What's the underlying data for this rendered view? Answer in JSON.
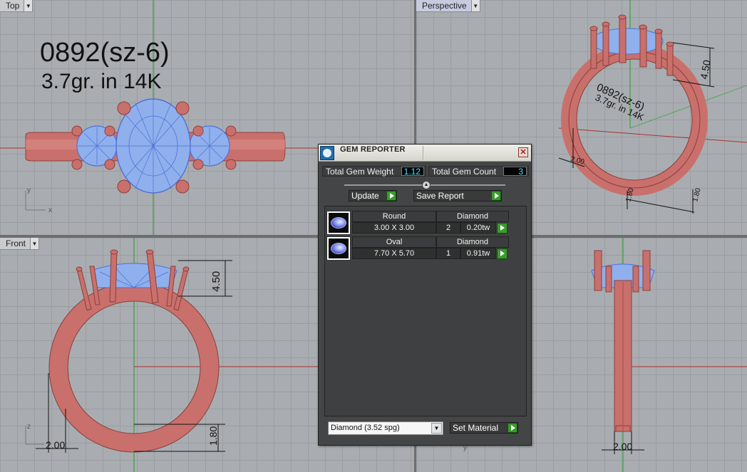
{
  "viewports": {
    "top": {
      "label": "Top",
      "annotation_line1": "0892(sz-6)",
      "annotation_line2": "3.7gr.  in 14K",
      "axis_y": "y",
      "axis_x": "x"
    },
    "perspective": {
      "label": "Perspective",
      "annotation_line1": "0892(sz-6)",
      "annotation_line2": "3.7gr.  in 14K",
      "dim_height": "4.50",
      "dim_left": "2.00",
      "dim_bottom_a": "1.80",
      "dim_bottom_b": "1.80"
    },
    "front": {
      "label": "Front",
      "dim_height": "4.50",
      "dim_width": "2.00",
      "dim_band": "1.80",
      "axis_z": "z"
    },
    "right": {
      "dim_width": "2.00",
      "axis_y": "y"
    }
  },
  "gem_reporter": {
    "title": "GEM REPORTER",
    "total_weight_label": "Total Gem Weight",
    "total_weight_value": "1.12",
    "total_count_label": "Total Gem Count",
    "total_count_value": "3",
    "update_label": "Update",
    "save_report_label": "Save Report",
    "gems": [
      {
        "shape": "Round",
        "material": "Diamond",
        "size": "3.00 X 3.00",
        "count": "2",
        "weight": "0.20tw"
      },
      {
        "shape": "Oval",
        "material": "Diamond",
        "size": "7.70 X 5.70",
        "count": "1",
        "weight": "0.91tw"
      }
    ],
    "material_select_value": "Diamond      (3.52 spg)",
    "set_material_label": "Set Material"
  },
  "colors": {
    "metal": "#c9706c",
    "metal_dark": "#9a4a47",
    "gem": "#8fb0ec",
    "gem_wire": "#4f6fd8",
    "viewport_bg": "#a9adb1",
    "axis_green": "#1fa11f",
    "axis_red": "#b03030",
    "value_cyan": "#4be0ff"
  }
}
